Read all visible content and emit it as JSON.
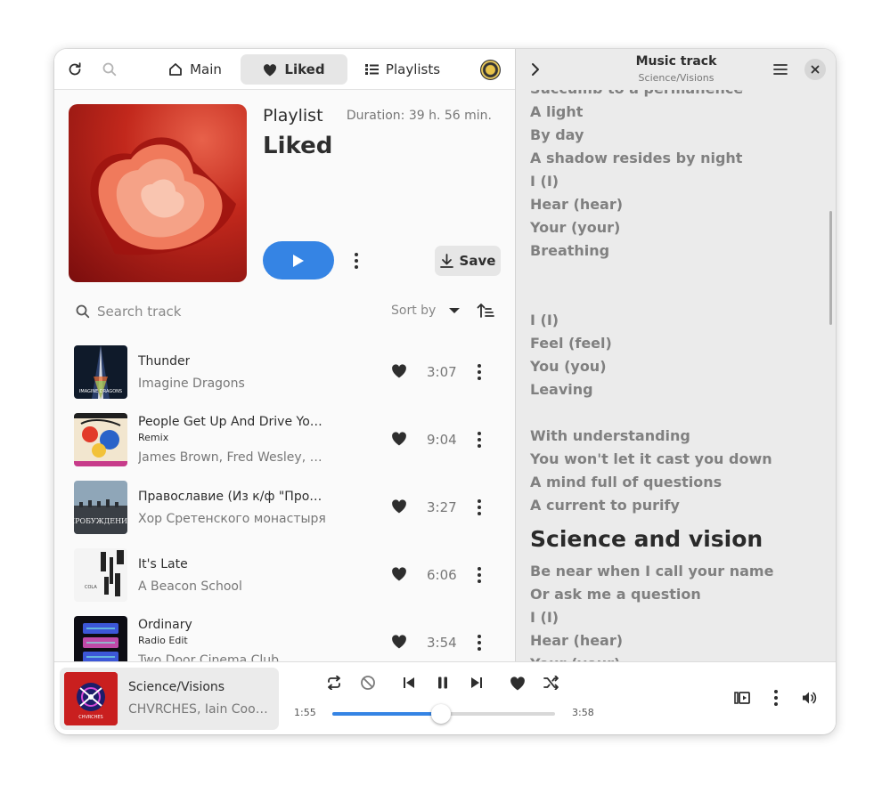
{
  "header": {
    "tabs": [
      {
        "label": "Main",
        "icon": "home-icon",
        "active": false
      },
      {
        "label": "Liked",
        "icon": "heart-icon",
        "active": true
      },
      {
        "label": "Playlists",
        "icon": "list-icon",
        "active": false
      }
    ]
  },
  "playlist": {
    "label": "Playlist",
    "title": "Liked",
    "duration": "Duration: 39 h. 56 min.",
    "save_label": "Save"
  },
  "search": {
    "placeholder": "Search track"
  },
  "sort": {
    "label": "Sort by"
  },
  "tracks": [
    {
      "title": "Thunder",
      "subtitle": "",
      "artist": "Imagine Dragons",
      "duration": "3:07",
      "liked": true
    },
    {
      "title": "People Get Up And Drive Your Funky Soul",
      "subtitle": "Remix",
      "artist": "James Brown, Fred Wesley, The J.B.'s",
      "duration": "9:04",
      "liked": true
    },
    {
      "title": "Православие (Из к/ф \"Пробуждение\")",
      "subtitle": "",
      "artist": "Хор Сретенского монастыря",
      "duration": "3:27",
      "liked": true
    },
    {
      "title": "It's Late",
      "subtitle": "",
      "artist": "A Beacon School",
      "duration": "6:06",
      "liked": true
    },
    {
      "title": "Ordinary",
      "subtitle": "Radio Edit",
      "artist": "Two Door Cinema Club",
      "duration": "3:54",
      "liked": true
    }
  ],
  "lyrics_panel": {
    "title": "Music track",
    "subtitle": "Science/Visions",
    "lines": [
      "Succumb to a permanence",
      "A light",
      "By day",
      "A shadow resides by night",
      "I (I)",
      "Hear (hear)",
      "Your (your)",
      "Breathing",
      "",
      "",
      "I (I)",
      "Feel (feel)",
      "You (you)",
      "Leaving",
      "",
      "With understanding",
      "You won't let it cast you down",
      "A mind full of questions",
      "A current to purify",
      "Science and vision",
      "Be near when I call your name",
      "Or ask me a question",
      "I (I)",
      "Hear (hear)",
      "Your (your)"
    ],
    "current_line_index": 19
  },
  "player": {
    "title": "Science/Visions",
    "artist": "CHVRCHES, Iain Cook, Martin Doherty, Lauren Mayberry",
    "elapsed": "1:55",
    "total": "3:58",
    "progress": 0.486
  },
  "colors": {
    "accent": "#3584e4",
    "window_bg": "#fafafa",
    "lyrics_bg": "#ebebeb"
  }
}
